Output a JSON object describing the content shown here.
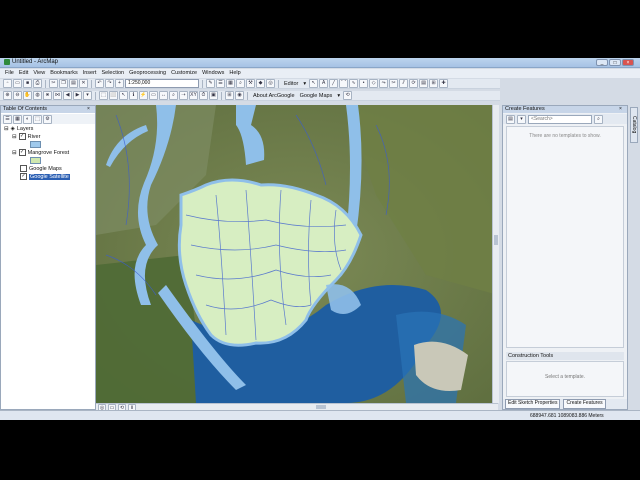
{
  "window": {
    "title": "Untitled - ArcMap"
  },
  "menu": [
    "File",
    "Edit",
    "View",
    "Bookmarks",
    "Insert",
    "Selection",
    "Geoprocessing",
    "Customize",
    "Windows",
    "Help"
  ],
  "toolbar": {
    "scale": "1:250,000",
    "editor_label": "Editor",
    "about_arcgoogle": "About ArcGoogle",
    "google_maps": "Google Maps"
  },
  "toc": {
    "title": "Table Of Contents",
    "root": "Layers",
    "layers": [
      {
        "name": "River",
        "checked": true,
        "color": "#9fc9ec"
      },
      {
        "name": "Mangrove Forest",
        "checked": true,
        "color": "#cfe8b0"
      },
      {
        "name": "Google Maps",
        "checked": false
      },
      {
        "name": "Google Satellite",
        "checked": true,
        "selected": true
      }
    ]
  },
  "create_features": {
    "title": "Create Features",
    "search_placeholder": "<Search>",
    "empty_message": "There are no templates to show.",
    "construction_tools_title": "Construction Tools",
    "construction_message": "Select a template.",
    "edit_sketch_properties": "Edit Sketch Properties",
    "create_features_tab": "Create Features"
  },
  "side_tab": "Catalog",
  "status": {
    "coordinates": "688947.681  1089083.886 Meters"
  },
  "colors": {
    "river": "#8fbfe9",
    "mangrove": "#d7eec2",
    "river_lines": "#3b5dd0",
    "sea": "#1f5ea0"
  }
}
